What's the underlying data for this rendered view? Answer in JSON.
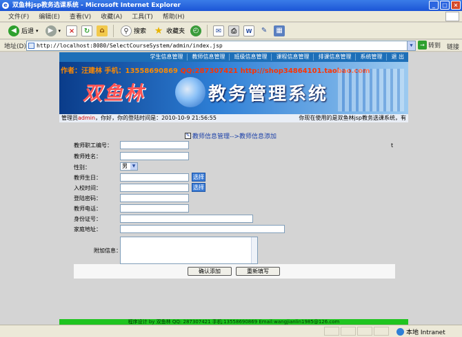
{
  "window": {
    "title": "双鱼林jsp教务选课系统 - Microsoft Internet Explorer"
  },
  "menu": [
    "文件(F)",
    "编辑(E)",
    "查看(V)",
    "收藏(A)",
    "工具(T)",
    "帮助(H)"
  ],
  "toolbar": {
    "back": "后退",
    "search": "搜索",
    "favorites": "收藏夹"
  },
  "address": {
    "label": "地址(D)",
    "url": "http://localhost:8080/SelectCourseSystem/admin/index.jsp",
    "go": "转到",
    "links": "链接"
  },
  "nav": [
    "学生信息管理",
    "教师信息管理",
    "班级信息管理",
    "课程信息管理",
    "排课信息管理",
    "系统管理",
    "退 出"
  ],
  "banner": {
    "authors_a": "作者：汪建林  手机：13558690869 ",
    "authors_b": "QQ:287307421 http://shop34864101.taobao.com",
    "brand": "双鱼林",
    "system": "教务管理系统"
  },
  "info": {
    "prefix": "管理员",
    "admin": "admin",
    "suffix": "，你好，你的登陆时间是：2010-10-9 21:56:55",
    "right": "你现在使用的是双鱼林jsp教务选课系统，有"
  },
  "breadcrumb": "教师信息管理-->教师信息添加",
  "stray_char": "t",
  "form": {
    "teacher_no": "教师职工编号：",
    "name": "教师姓名：",
    "gender": "性别：",
    "gender_value": "男",
    "birthday": "教师生日：",
    "pick": "选择",
    "arrival": "入校时间：",
    "password": "登陆密码：",
    "phone": "教师电话：",
    "id_card": "身份证号：",
    "address": "家庭地址：",
    "notes": "附加信息："
  },
  "buttons": {
    "submit": "确认添加",
    "reset": "重新填写"
  },
  "footer": "程序设计 by 双鱼林  QQ: 287307421 手机:13558690869 Email:wangjianlin1985@126.com",
  "status": {
    "zone": "本地 Intranet"
  }
}
